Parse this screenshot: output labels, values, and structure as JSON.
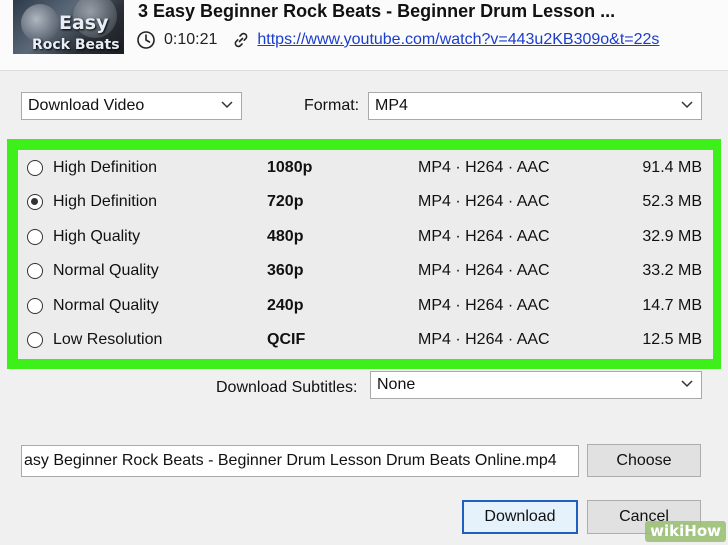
{
  "video": {
    "thumbnail_line1": "Easy",
    "thumbnail_line2": "Rock Beats",
    "title": "3 Easy Beginner Rock Beats - Beginner Drum Lesson ...",
    "duration": "0:10:21",
    "url": "https://www.youtube.com/watch?v=443u2KB309o&t=22s"
  },
  "download_type": {
    "value": "Download Video"
  },
  "format": {
    "label": "Format:",
    "value": "MP4"
  },
  "quality_options": [
    {
      "name": "High Definition",
      "resolution": "1080p",
      "codec": "MP4 · H264 · AAC",
      "size": "91.4 MB",
      "selected": false
    },
    {
      "name": "High Definition",
      "resolution": "720p",
      "codec": "MP4 · H264 · AAC",
      "size": "52.3 MB",
      "selected": true
    },
    {
      "name": "High Quality",
      "resolution": "480p",
      "codec": "MP4 · H264 · AAC",
      "size": "32.9 MB",
      "selected": false
    },
    {
      "name": "Normal Quality",
      "resolution": "360p",
      "codec": "MP4 · H264 · AAC",
      "size": "33.2 MB",
      "selected": false
    },
    {
      "name": "Normal Quality",
      "resolution": "240p",
      "codec": "MP4 · H264 · AAC",
      "size": "14.7 MB",
      "selected": false
    },
    {
      "name": "Low Resolution",
      "resolution": "QCIF",
      "codec": "MP4 · H264 · AAC",
      "size": "12.5 MB",
      "selected": false
    }
  ],
  "subtitles": {
    "label": "Download Subtitles:",
    "value": "None"
  },
  "output": {
    "filename": "asy Beginner Rock Beats - Beginner Drum Lesson   Drum Beats Online.mp4",
    "choose_label": "Choose"
  },
  "actions": {
    "download_label": "Download",
    "cancel_label": "Cancel"
  },
  "watermark": "wikiHow",
  "colors": {
    "highlight": "#3ef019",
    "link": "#1a3dcc",
    "primary_border": "#1f5fbf"
  }
}
